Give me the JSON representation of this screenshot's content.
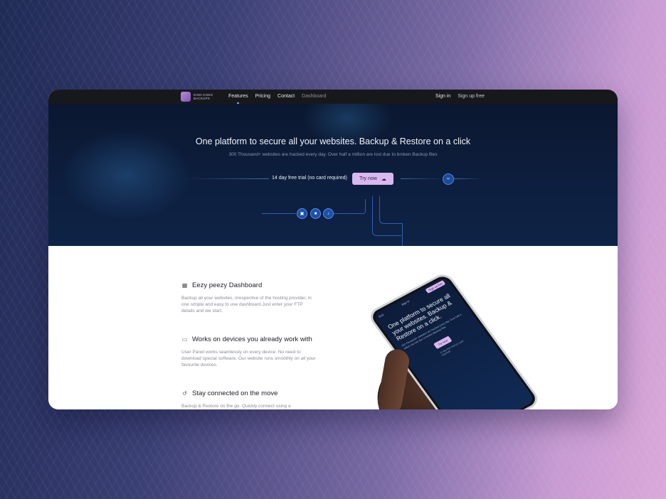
{
  "nav": {
    "logo_text": "KING KONG BACKUPS",
    "links": [
      "Features",
      "Pricing",
      "Contact",
      "Dashboard"
    ],
    "sign_in": "Sign in",
    "sign_up": "Sign up free"
  },
  "hero": {
    "title": "One platform to secure all your websites. Backup & Restore on a click",
    "subtitle": "300 Thousand+ websites are hacked every day. Over half a million are lost due to broken Backup files",
    "trial_text": "14 day free trial (no card required)",
    "try_button": "Try now",
    "icons": [
      "cloud-upload-icon",
      "code-icon",
      "image-icon",
      "video-icon",
      "music-icon"
    ]
  },
  "features": [
    {
      "title": "Eezy peezy Dashboard",
      "body": "Backup all your websites, irrespective of the hosting provider, in one simple and easy to use dashboard.Just enter your FTP details and we start.",
      "icon": "dashboard-icon"
    },
    {
      "title": "Works on devices you already work with",
      "body": "User Panel works seamlessly on every device. No need to download special software. Our website runs smoothly on all your favourite devices.",
      "icon": "devices-icon"
    },
    {
      "title": "Stay connected on the move",
      "body": "Backup & Restore on the go. Quickly connect using a",
      "icon": "history-icon"
    }
  ],
  "phone": {
    "time": "9:41",
    "sign_in": "Sign in",
    "sign_up": "Sign up free",
    "title": "One platform to secure all your websites. Backup & Restore on a click.",
    "subtitle": "300 Thousand+ websites are hacked every day. Over half a million are lost due to broken Backup files",
    "try_button": "Try now",
    "trial_text": "14 day free trial (no card required)"
  },
  "colors": {
    "accent": "#d9b7ef",
    "hero_bg": "#0d1f3f",
    "nav_bg": "#17181c"
  }
}
